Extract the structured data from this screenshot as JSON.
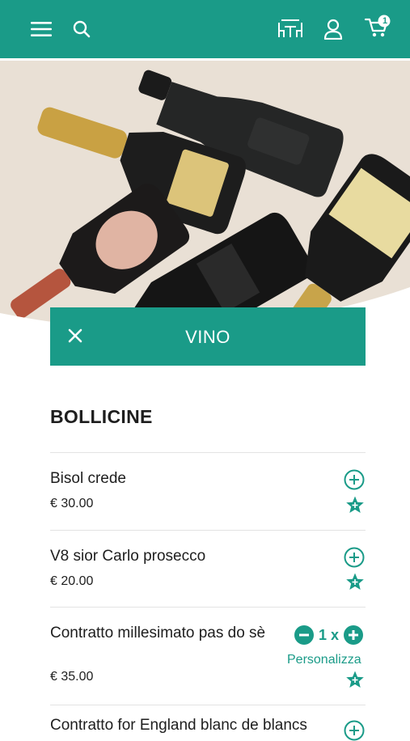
{
  "header": {
    "menu_icon": "hamburger-menu-icon",
    "search_icon": "search-icon",
    "table_icon": "restaurant-table-icon",
    "account_icon": "user-icon",
    "cart_icon": "cart-icon",
    "cart_count": "1",
    "background_color": "#1a9b88"
  },
  "hero": {
    "image": "champagne-bottles-photo"
  },
  "section": {
    "title": "VINO",
    "close_icon": "close-icon"
  },
  "category": {
    "title": "BOLLICINE"
  },
  "items": [
    {
      "name": "Bisol crede",
      "price": "€ 30.00"
    },
    {
      "name": "V8 sior Carlo prosecco",
      "price": "€ 20.00"
    },
    {
      "name": "Contratto millesimato pas do sè",
      "price": "€ 35.00",
      "quantity": "1 x",
      "customize": "Personalizza"
    },
    {
      "name": "Contratto for England blanc de blancs"
    }
  ],
  "colors": {
    "accent": "#1a9b88",
    "text": "#1e1e1e"
  }
}
